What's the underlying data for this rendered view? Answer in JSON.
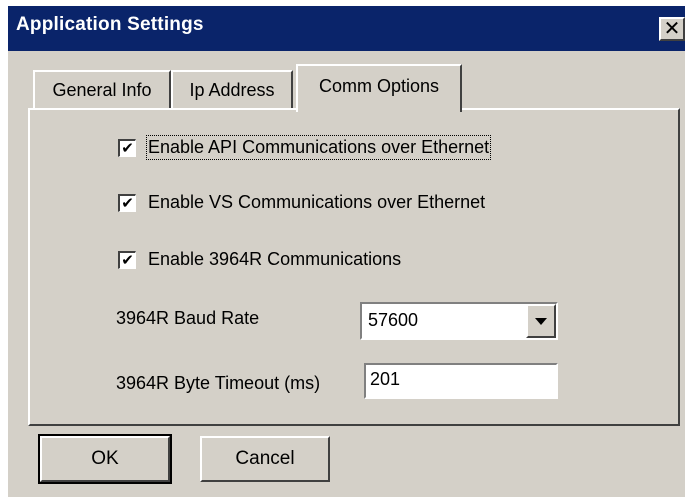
{
  "window": {
    "title": "Application Settings",
    "close_label": "✕"
  },
  "tabs": [
    {
      "label": "General Info",
      "active": false
    },
    {
      "label": "Ip Address",
      "active": false
    },
    {
      "label": "Comm Options",
      "active": true
    }
  ],
  "options": [
    {
      "label": "Enable API Communications over Ethernet",
      "checked": true,
      "focused": true
    },
    {
      "label": "Enable VS Communications over Ethernet",
      "checked": true,
      "focused": false
    },
    {
      "label": "Enable 3964R Communications",
      "checked": true,
      "focused": false
    }
  ],
  "baud_rate": {
    "label": "3964R Baud Rate",
    "value": "57600"
  },
  "byte_timeout": {
    "label": "3964R Byte Timeout (ms)",
    "value": "201"
  },
  "buttons": {
    "ok_label": "OK",
    "cancel_label": "Cancel"
  },
  "check_glyph": "✔"
}
